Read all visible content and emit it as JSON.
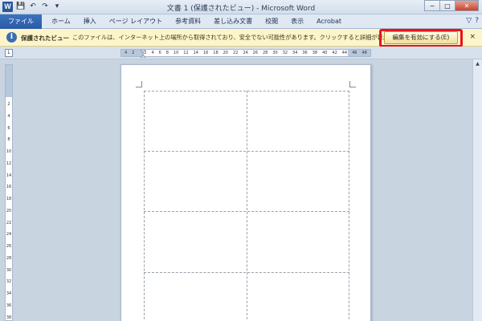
{
  "window": {
    "title": "文書 1 (保護されたビュー) - Microsoft Word",
    "app_icon_letter": "W",
    "controls": {
      "minimize": "−",
      "maximize": "□",
      "close": "✕"
    }
  },
  "quick_access": {
    "save": "💾",
    "undo": "↶",
    "redo": "↷",
    "customize": "▾"
  },
  "ribbon": {
    "tabs": [
      "ファイル",
      "ホーム",
      "挿入",
      "ページ レイアウト",
      "参考資料",
      "差し込み文書",
      "校閲",
      "表示",
      "Acrobat"
    ],
    "right_icons": {
      "minimize_ribbon": "▽",
      "help": "?"
    }
  },
  "message_bar": {
    "title": "保護されたビュー",
    "text": "このファイルは、インターネット上の場所から取得されており、安全でない可能性があります。クリックすると詳細が表示されます。",
    "enable_button": "編集を有効にする(E)",
    "close": "×",
    "info_glyph": "i"
  },
  "ruler": {
    "corner": "L",
    "horizontal_numbers": [
      "4",
      "2",
      "",
      "2",
      "4",
      "6",
      "8",
      "10",
      "12",
      "14",
      "16",
      "18",
      "20",
      "22",
      "24",
      "26",
      "28",
      "30",
      "32",
      "34",
      "36",
      "38",
      "40",
      "42",
      "44",
      "46",
      "48"
    ],
    "vertical_numbers": [
      "2",
      "4",
      "6",
      "8",
      "10",
      "12",
      "14",
      "16",
      "18",
      "20",
      "22",
      "24",
      "26",
      "28",
      "30",
      "32",
      "34",
      "36",
      "38"
    ]
  },
  "scrollbar": {
    "up_arrow": "▲"
  },
  "colors": {
    "file_tab": "#2a5aa5",
    "message_bar": "#fdf5c9",
    "highlight": "#e8141a",
    "info_icon": "#3a6db4"
  }
}
